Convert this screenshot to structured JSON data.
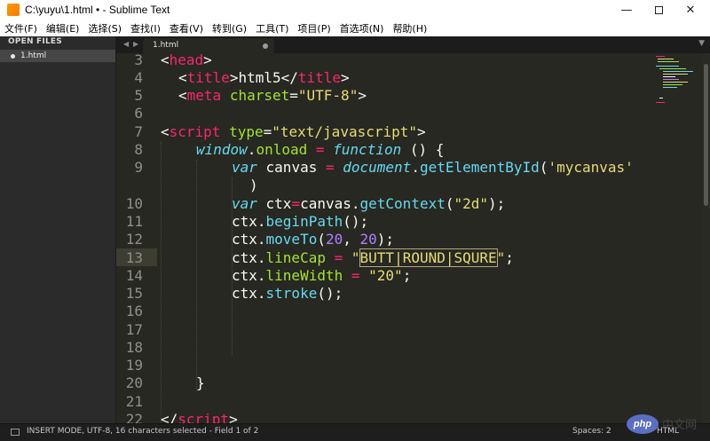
{
  "window": {
    "title": "C:\\yuyu\\1.html • - Sublime Text",
    "minimize_glyph": "—",
    "close_glyph": "✕"
  },
  "menu": [
    "文件(F)",
    "编辑(E)",
    "选择(S)",
    "查找(I)",
    "查看(V)",
    "转到(G)",
    "工具(T)",
    "项目(P)",
    "首选项(N)",
    "帮助(H)"
  ],
  "sidebar": {
    "header": "OPEN FILES",
    "files": [
      {
        "label": "1.html"
      }
    ]
  },
  "tabs": {
    "nav_left": "◀",
    "nav_right": "▶",
    "items": [
      {
        "label": "1.html",
        "dirty": true
      }
    ],
    "dropdown": "▼"
  },
  "editor": {
    "line_numbers": [
      "3",
      "4",
      "5",
      "6",
      "7",
      "8",
      "9",
      "",
      "10",
      "11",
      "12",
      "13",
      "14",
      "15",
      "16",
      "17",
      "18",
      "19",
      "20",
      "21",
      "22"
    ],
    "current_line": "13",
    "selection": "BUTT|ROUND|SQURE",
    "code": {
      "l3": [
        "<",
        "head",
        ">"
      ],
      "l4": [
        "<",
        "title",
        ">html5</",
        "title",
        ">"
      ],
      "l6": [
        "<",
        "meta",
        " ",
        "charset",
        "=",
        "\"UTF-8\"",
        ">"
      ],
      "l7": [
        "<",
        "script",
        " ",
        "type",
        "=",
        "\"text/javascript\"",
        ">"
      ],
      "l8": [
        "window",
        ".",
        "onload",
        " ",
        "=",
        " ",
        "function",
        " () {"
      ],
      "l9": [
        "var",
        " canvas ",
        "=",
        " ",
        "document",
        ".",
        "getElementById",
        "(",
        "'mycanvas'"
      ],
      "l9b": [
        ")"
      ],
      "l10": [
        "var",
        " ctx",
        "=",
        "canvas.",
        "getContext",
        "(",
        "\"2d\"",
        ");"
      ],
      "l11": [
        "ctx.",
        "beginPath",
        "();"
      ],
      "l12": [
        "ctx.",
        "moveTo",
        "(",
        "20",
        ", ",
        "20",
        ");"
      ],
      "l13": [
        "ctx.",
        "lineCap",
        " ",
        "=",
        " ",
        "\"",
        "BUTT|ROUND|SQURE",
        "\"",
        ";"
      ],
      "l14": [
        "ctx.",
        "lineWidth",
        " ",
        "=",
        " ",
        "\"20\"",
        ";"
      ],
      "l15": [
        "ctx.",
        "stroke",
        "();"
      ],
      "l20": [
        "}"
      ],
      "l22": [
        "</",
        "script",
        ">"
      ]
    }
  },
  "status": {
    "mode": "INSERT MODE, UTF-8, 16 characters selected - Field 1 of 2",
    "spaces": "Spaces: 2",
    "syntax": "HTML"
  },
  "watermark": {
    "badge": "php",
    "text": "中文网"
  },
  "colors": {
    "editor_bg": "#272822",
    "sidebar_bg": "#2b2b2b",
    "tag": "#f92672",
    "attribute": "#a6e22e",
    "string": "#e6db74",
    "keyword": "#66d9ef",
    "number": "#ae81ff",
    "text": "#f8f8f2",
    "gutter_text": "#8f908a"
  }
}
